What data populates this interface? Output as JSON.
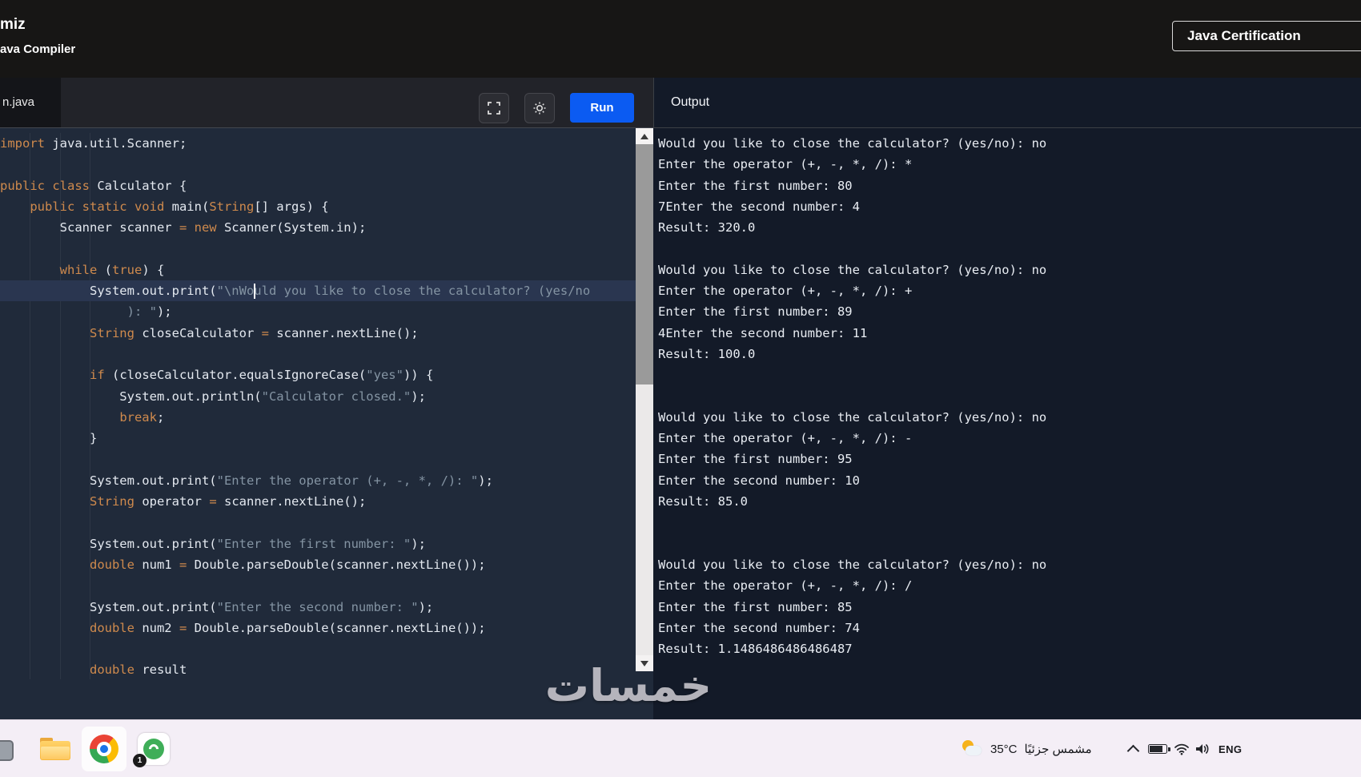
{
  "header": {
    "brand_partial": "miz",
    "subtitle_partial": "ava Compiler",
    "cert_button_label": "Java Certification"
  },
  "toolbar": {
    "tab_label": "n.java",
    "run_label": "Run",
    "icons": [
      "fullscreen-icon",
      "theme-sun-icon"
    ]
  },
  "colors": {
    "accent_blue": "#0b5bf2",
    "keyword_orange": "#cf8a4d",
    "string_gray": "#8494a3",
    "editor_bg": "#202a3a",
    "output_bg": "#131a28",
    "taskbar_bg": "#f4eef6"
  },
  "editor": {
    "active_line": 7,
    "caret": {
      "line": 7,
      "col": 34
    },
    "lines": [
      {
        "t": [
          [
            "k",
            "import"
          ],
          [
            "p",
            " java.util.Scanner;"
          ]
        ]
      },
      {
        "t": []
      },
      {
        "t": [
          [
            "k",
            "public class"
          ],
          [
            "p",
            " Calculator {"
          ]
        ]
      },
      {
        "t": [
          [
            "p",
            "    "
          ],
          [
            "k",
            "public static void"
          ],
          [
            "p",
            " main("
          ],
          [
            "k",
            "String"
          ],
          [
            "p",
            "[] args) {"
          ]
        ]
      },
      {
        "t": [
          [
            "p",
            "        Scanner scanner "
          ],
          [
            "k",
            "= new"
          ],
          [
            "p",
            " Scanner(System.in);"
          ]
        ]
      },
      {
        "t": []
      },
      {
        "t": [
          [
            "p",
            "        "
          ],
          [
            "k",
            "while"
          ],
          [
            "p",
            " ("
          ],
          [
            "k",
            "true"
          ],
          [
            "p",
            ") {"
          ]
        ]
      },
      {
        "t": [
          [
            "p",
            "            System.out.print("
          ],
          [
            "s",
            "\"\\nWould you like to close the calculator? (yes/no"
          ]
        ]
      },
      {
        "t": [
          [
            "s",
            "                 ): \""
          ],
          [
            "p",
            ");"
          ]
        ]
      },
      {
        "t": [
          [
            "p",
            "            "
          ],
          [
            "k",
            "String"
          ],
          [
            "p",
            " closeCalculator "
          ],
          [
            "k",
            "="
          ],
          [
            "p",
            " scanner.nextLine();"
          ]
        ]
      },
      {
        "t": []
      },
      {
        "t": [
          [
            "p",
            "            "
          ],
          [
            "k",
            "if"
          ],
          [
            "p",
            " (closeCalculator.equalsIgnoreCase("
          ],
          [
            "s",
            "\"yes\""
          ],
          [
            "p",
            ")) {"
          ]
        ]
      },
      {
        "t": [
          [
            "p",
            "                System.out.println("
          ],
          [
            "s",
            "\"Calculator closed.\""
          ],
          [
            "p",
            ");"
          ]
        ]
      },
      {
        "t": [
          [
            "p",
            "                "
          ],
          [
            "k",
            "break"
          ],
          [
            "p",
            ";"
          ]
        ]
      },
      {
        "t": [
          [
            "p",
            "            }"
          ]
        ]
      },
      {
        "t": []
      },
      {
        "t": [
          [
            "p",
            "            System.out.print("
          ],
          [
            "s",
            "\"Enter the operator (+, -, *, /): \""
          ],
          [
            "p",
            ");"
          ]
        ]
      },
      {
        "t": [
          [
            "p",
            "            "
          ],
          [
            "k",
            "String"
          ],
          [
            "p",
            " operator "
          ],
          [
            "k",
            "="
          ],
          [
            "p",
            " scanner.nextLine();"
          ]
        ]
      },
      {
        "t": []
      },
      {
        "t": [
          [
            "p",
            "            System.out.print("
          ],
          [
            "s",
            "\"Enter the first number: \""
          ],
          [
            "p",
            ");"
          ]
        ]
      },
      {
        "t": [
          [
            "p",
            "            "
          ],
          [
            "k",
            "double"
          ],
          [
            "p",
            " num1 "
          ],
          [
            "k",
            "="
          ],
          [
            "p",
            " Double.parseDouble(scanner.nextLine());"
          ]
        ]
      },
      {
        "t": []
      },
      {
        "t": [
          [
            "p",
            "            System.out.print("
          ],
          [
            "s",
            "\"Enter the second number: \""
          ],
          [
            "p",
            ");"
          ]
        ]
      },
      {
        "t": [
          [
            "p",
            "            "
          ],
          [
            "k",
            "double"
          ],
          [
            "p",
            " num2 "
          ],
          [
            "k",
            "="
          ],
          [
            "p",
            " Double.parseDouble(scanner.nextLine());"
          ]
        ]
      },
      {
        "t": []
      },
      {
        "t": [
          [
            "p",
            "            "
          ],
          [
            "k",
            "double"
          ],
          [
            "p",
            " result"
          ]
        ]
      }
    ]
  },
  "output": {
    "title": "Output",
    "lines": [
      "Would you like to close the calculator? (yes/no): no",
      "Enter the operator (+, -, *, /): *",
      "Enter the first number: 80",
      "7Enter the second number: 4",
      "Result: 320.0",
      "",
      "Would you like to close the calculator? (yes/no): no",
      "Enter the operator (+, -, *, /): +",
      "Enter the first number: 89",
      "4Enter the second number: 11",
      "Result: 100.0",
      "",
      "",
      "Would you like to close the calculator? (yes/no): no",
      "Enter the operator (+, -, *, /): -",
      "Enter the first number: 95",
      "Enter the second number: 10",
      "Result: 85.0",
      "",
      "",
      "Would you like to close the calculator? (yes/no): no",
      "Enter the operator (+, -, *, /): /",
      "Enter the first number: 85",
      "Enter the second number: 74",
      "Result: 1.1486486486486487"
    ]
  },
  "watermark": {
    "text": "خمسات"
  },
  "taskbar": {
    "temp": "35°C",
    "condition": "مشمس جزئيًا",
    "lang": "ENG",
    "badge": "1"
  }
}
